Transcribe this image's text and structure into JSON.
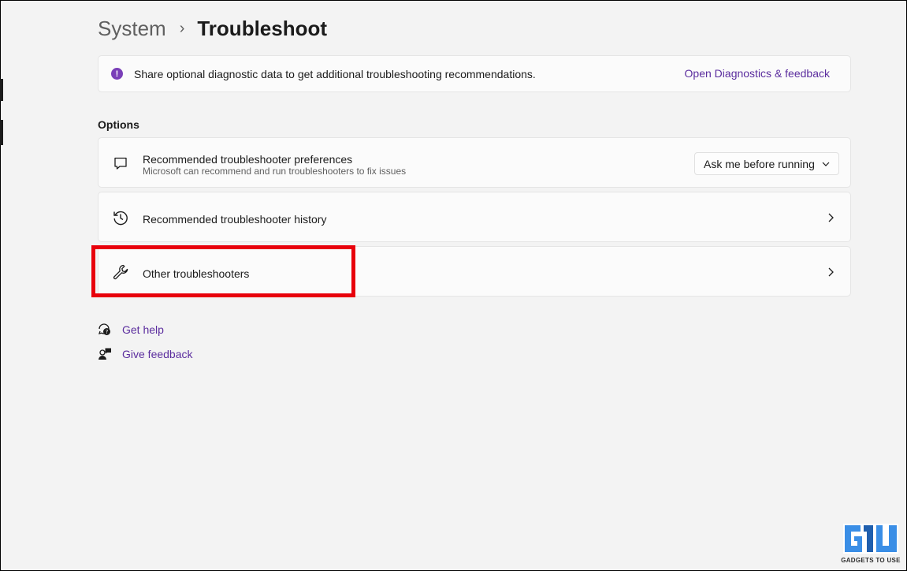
{
  "breadcrumb": {
    "parent": "System",
    "separator": "›",
    "current": "Troubleshoot"
  },
  "info_banner": {
    "icon": "info-icon",
    "text": "Share optional diagnostic data to get additional troubleshooting recommendations.",
    "link": "Open Diagnostics & feedback"
  },
  "options": {
    "heading": "Options",
    "items": [
      {
        "icon": "chat-bubble-icon",
        "title": "Recommended troubleshooter preferences",
        "subtitle": "Microsoft can recommend and run troubleshooters to fix issues",
        "dropdown_value": "Ask me before running"
      },
      {
        "icon": "history-icon",
        "title": "Recommended troubleshooter history"
      },
      {
        "icon": "wrench-icon",
        "title": "Other troubleshooters",
        "highlighted": true
      }
    ]
  },
  "help_links": [
    {
      "icon": "get-help-icon",
      "label": "Get help"
    },
    {
      "icon": "feedback-icon",
      "label": "Give feedback"
    }
  ],
  "watermark": {
    "brand_text": "GADGETS TO USE"
  },
  "colors": {
    "accent_link": "#5b2d9e",
    "info_icon": "#7a3fb8",
    "highlight": "#e8000b",
    "background": "#f3f3f3",
    "card": "#fbfbfb"
  }
}
